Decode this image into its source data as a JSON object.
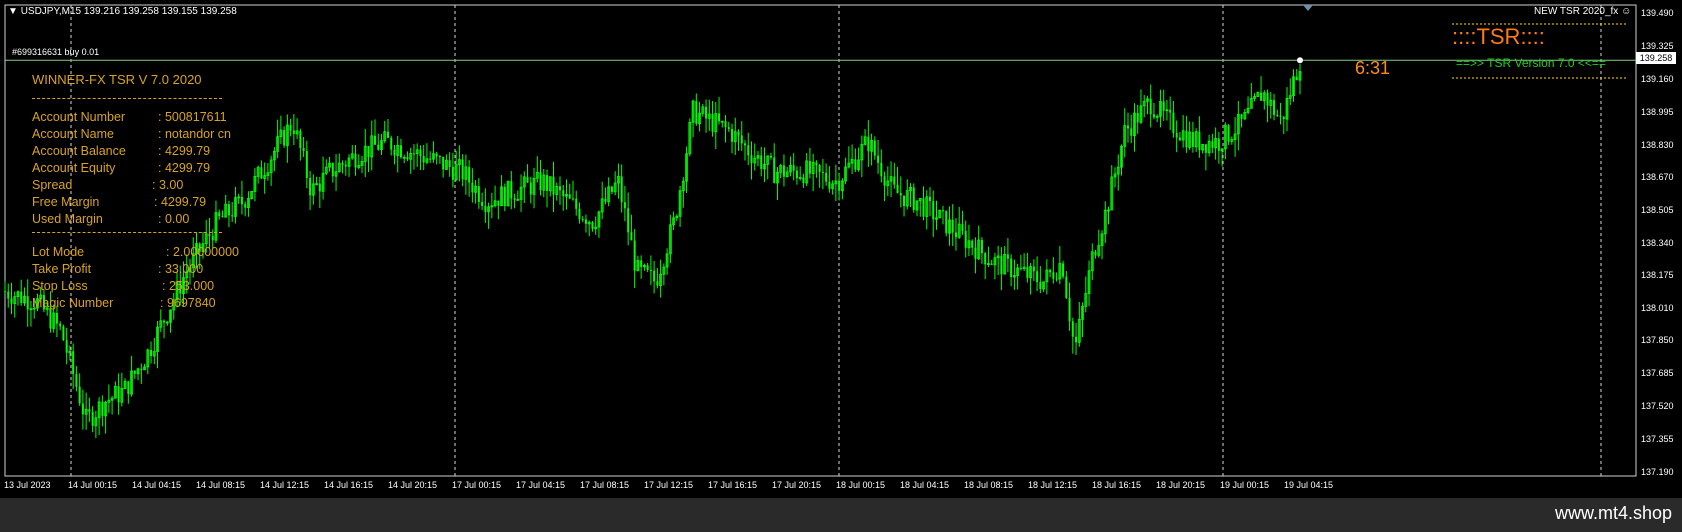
{
  "header": {
    "symbol_line": "USDJPY,M15  139.216 139.258 139.155 139.258",
    "order_label": "#699316631 buy 0.01",
    "new_tsr_label": "NEW TSR  2020_fx"
  },
  "panel": {
    "title": "WINNER-FX TSR V 7.0  2020",
    "account_number": {
      "label": "Account Number",
      "value": ": 500817611"
    },
    "account_name": {
      "label": "Account Name",
      "value": ": notandor cn"
    },
    "account_balance": {
      "label": "Account Balance",
      "value": ": 4299.79"
    },
    "account_equity": {
      "label": "Account Equity",
      "value": ": 4299.79"
    },
    "spread": {
      "label": "Spread",
      "value": ": 3.00"
    },
    "free_margin": {
      "label": "Free Margin",
      "value": ": 4299.79"
    },
    "used_margin": {
      "label": "Used Margin",
      "value": ": 0.00"
    },
    "lot_mode": {
      "label": "Lot Mode",
      "value": ": 2.00000000"
    },
    "take_profit": {
      "label": "Take Profit",
      "value": ": 33.000"
    },
    "stop_loss": {
      "label": "Stop Loss",
      "value": ": 253.000"
    },
    "magic_number": {
      "label": "Magic Number",
      "value": ": 9697840"
    }
  },
  "timer": "6:31",
  "tsr": {
    "title": "::::TSR::::",
    "version": "==>> TSR Version 7.0 <<=="
  },
  "watermark": "www.mt4.shop",
  "current_price": "139.258",
  "colors": {
    "background": "#000000",
    "candle": "#00ff00",
    "panel_text": "#d9a321",
    "timer": "#ff8c1a",
    "tsr_title": "#ff7a14",
    "tsr_version": "#1ed11e"
  },
  "chart_data": {
    "type": "candlestick",
    "symbol": "USDJPY",
    "timeframe": "M15",
    "y_ticks": [
      "139.490",
      "139.325",
      "139.160",
      "138.995",
      "138.830",
      "138.670",
      "138.505",
      "138.340",
      "138.175",
      "138.010",
      "137.850",
      "137.685",
      "137.520",
      "137.355",
      "137.190"
    ],
    "ylim": [
      137.19,
      139.49
    ],
    "x_ticks": [
      "13 Jul 2023",
      "14 Jul 00:15",
      "14 Jul 04:15",
      "14 Jul 08:15",
      "14 Jul 12:15",
      "14 Jul 16:15",
      "14 Jul 20:15",
      "17 Jul 00:15",
      "17 Jul 04:15",
      "17 Jul 08:15",
      "17 Jul 12:15",
      "17 Jul 16:15",
      "17 Jul 20:15",
      "18 Jul 00:15",
      "18 Jul 04:15",
      "18 Jul 08:15",
      "18 Jul 12:15",
      "18 Jul 16:15",
      "18 Jul 20:15",
      "19 Jul 00:15",
      "19 Jul 04:15"
    ],
    "close_path": [
      [
        0,
        138.1
      ],
      [
        0.5,
        138.05
      ],
      [
        0.9,
        137.9
      ],
      [
        1.3,
        137.45
      ],
      [
        1.6,
        137.55
      ],
      [
        1.9,
        137.6
      ],
      [
        2.3,
        137.8
      ],
      [
        2.6,
        138.0
      ],
      [
        2.9,
        138.2
      ],
      [
        3.4,
        138.45
      ],
      [
        3.8,
        138.55
      ],
      [
        4.2,
        138.75
      ],
      [
        4.6,
        138.95
      ],
      [
        4.9,
        138.6
      ],
      [
        5.2,
        138.7
      ],
      [
        5.7,
        138.8
      ],
      [
        6.1,
        138.85
      ],
      [
        6.5,
        138.8
      ],
      [
        6.9,
        138.75
      ],
      [
        7.3,
        138.7
      ],
      [
        7.7,
        138.55
      ],
      [
        8.1,
        138.6
      ],
      [
        8.6,
        138.65
      ],
      [
        9.0,
        138.55
      ],
      [
        9.4,
        138.45
      ],
      [
        9.8,
        138.65
      ],
      [
        10.1,
        138.2
      ],
      [
        10.4,
        138.15
      ],
      [
        10.7,
        138.45
      ],
      [
        11.0,
        139.0
      ],
      [
        11.3,
        138.95
      ],
      [
        11.6,
        138.9
      ],
      [
        11.9,
        138.8
      ],
      [
        12.3,
        138.7
      ],
      [
        12.8,
        138.7
      ],
      [
        13.3,
        138.65
      ],
      [
        13.8,
        138.85
      ],
      [
        14.2,
        138.6
      ],
      [
        14.6,
        138.55
      ],
      [
        15.0,
        138.45
      ],
      [
        15.4,
        138.35
      ],
      [
        15.8,
        138.25
      ],
      [
        16.2,
        138.2
      ],
      [
        16.6,
        138.15
      ],
      [
        16.9,
        138.25
      ],
      [
        17.1,
        137.8
      ],
      [
        17.4,
        138.3
      ],
      [
        17.6,
        138.5
      ],
      [
        17.9,
        138.9
      ],
      [
        18.3,
        139.05
      ],
      [
        18.6,
        138.95
      ],
      [
        19.0,
        138.85
      ],
      [
        19.4,
        138.85
      ],
      [
        19.8,
        138.95
      ],
      [
        20.1,
        139.1
      ],
      [
        20.4,
        138.95
      ],
      [
        20.7,
        139.258
      ]
    ]
  }
}
